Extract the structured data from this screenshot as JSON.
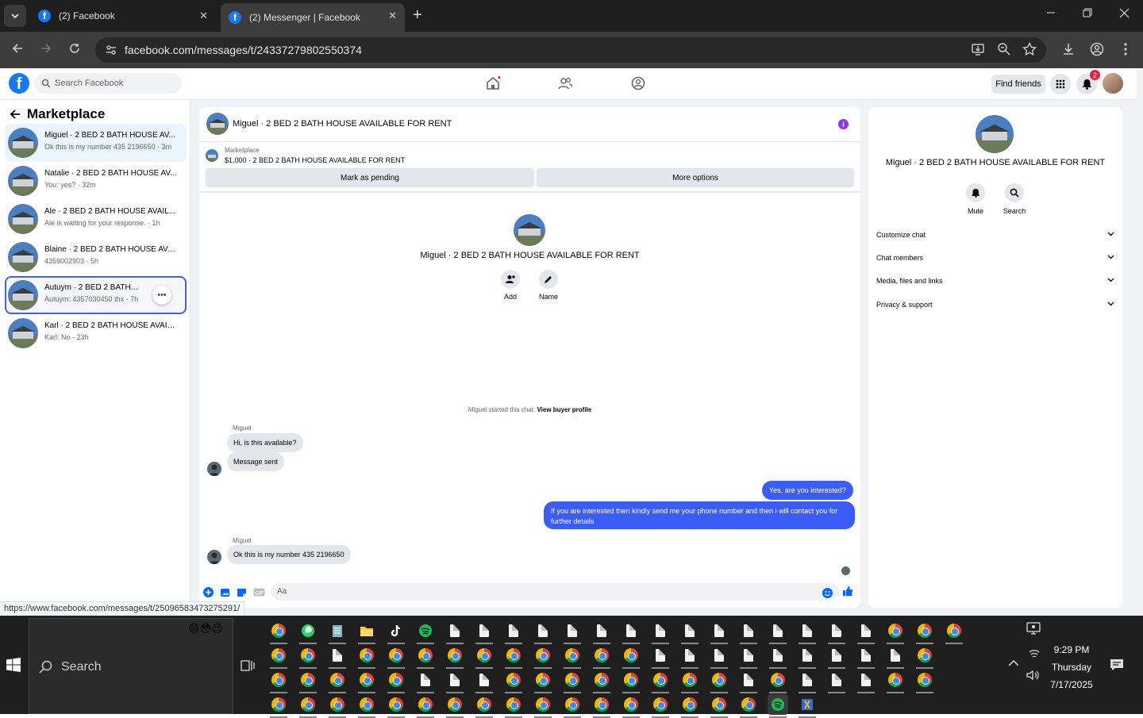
{
  "browser": {
    "tabs": [
      {
        "label": "(2) Facebook",
        "active": false
      },
      {
        "label": "(2) Messenger | Facebook",
        "active": true
      }
    ],
    "url": "facebook.com/messages/t/24337279802550374",
    "status_url": "https://www.facebook.com/messages/t/25096583473275291/"
  },
  "fb": {
    "search_placeholder": "Search Facebook",
    "find_friends": "Find friends",
    "notifications_count": "2",
    "logo_letter": "f"
  },
  "sidebar": {
    "title": "Marketplace",
    "conversations": [
      {
        "title": "Miguel · 2 BED 2 BATH HOUSE AV...",
        "subtitle": "Ok this is my number 435 2196650 · 3m"
      },
      {
        "title": "Natalie · 2 BED 2 BATH HOUSE AV...",
        "subtitle": "You: yes? · 32m"
      },
      {
        "title": "Ale · 2 BED 2 BATH HOUSE AVAIL...",
        "subtitle": "Ale is waiting for your response. · 1h"
      },
      {
        "title": "Blaine · 2 BED 2 BATH HOUSE AVA...",
        "subtitle": "4359002903 · 5h"
      },
      {
        "title": "Autuym · 2 BED 2 BATH HOUSE",
        "subtitle": "Autuym: 4357030450 thx · 7h"
      },
      {
        "title": "Karl · 2 BED 2 BATH HOUSE AVAIL...",
        "subtitle": "Karl: No · 23h"
      }
    ],
    "more_label": "•••"
  },
  "chat": {
    "title": "Miguel · 2 BED 2 BATH HOUSE AVAILABLE FOR RENT",
    "info_label": "i",
    "marketplace_label": "Marketplace",
    "listing": "$1,000 · 2 BED 2 BATH HOUSE AVAILABLE FOR RENT",
    "mark_pending": "Mark as pending",
    "more_options": "More options",
    "center_title": "Miguel · 2 BED 2 BATH HOUSE AVAILABLE FOR RENT",
    "add_label": "Add",
    "name_label": "Name",
    "started_text": "Miguel started this chat.",
    "view_buyer": "View buyer profile",
    "messages": [
      {
        "sender": "Miguel",
        "text": "Hi, is this available?",
        "dir": "in"
      },
      {
        "text": "Message sent",
        "dir": "in"
      },
      {
        "text": "Yes, are you interested?",
        "dir": "out"
      },
      {
        "text": "If you are interested then kindly send me your phone number and then i will contact you for further details",
        "dir": "out"
      },
      {
        "sender": "Miguel",
        "text": "Ok this is my number 435 2196650",
        "dir": "in"
      }
    ],
    "composer_placeholder": "Aa"
  },
  "details": {
    "title": "Miguel · 2 BED 2 BATH HOUSE AVAILABLE FOR RENT",
    "mute": "Mute",
    "search": "Search",
    "sections": [
      "Customize chat",
      "Chat members",
      "Media, files and links",
      "Privacy & support"
    ]
  },
  "taskbar": {
    "search": "Search",
    "time": "9:29 PM",
    "day": "Thursday",
    "date": "7/17/2025",
    "emoji": "😄😳😍"
  },
  "colors": {
    "fb_blue": "#1877f2",
    "bubble_out": "#3b5cf6",
    "info_purple": "#9333ea",
    "badge_red": "#e41e3f"
  }
}
